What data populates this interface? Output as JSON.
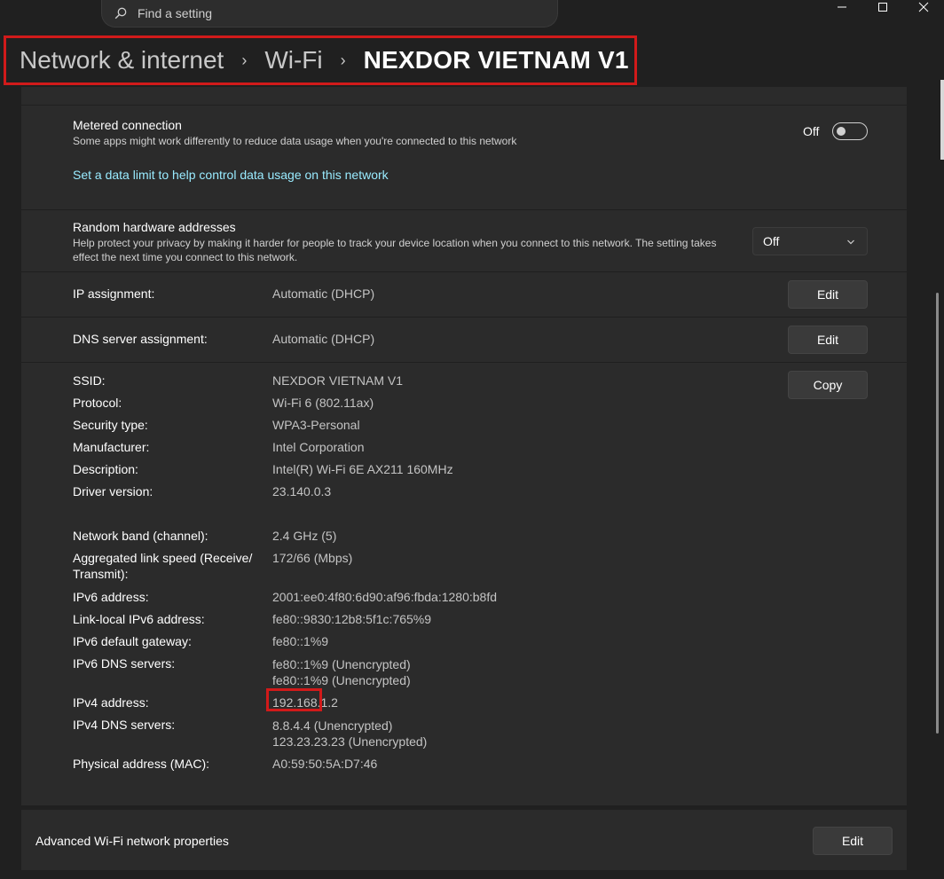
{
  "search": {
    "placeholder": "Find a setting"
  },
  "breadcrumb": {
    "items": [
      "Network & internet",
      "Wi-Fi"
    ],
    "current": "NEXDOR VIETNAM V1"
  },
  "metered": {
    "title": "Metered connection",
    "description": "Some apps might work differently to reduce data usage when you're connected to this network",
    "toggle_state": "Off",
    "link": "Set a data limit to help control data usage on this network"
  },
  "random_hw": {
    "title": "Random hardware addresses",
    "description": "Help protect your privacy by making it harder for people to track your device location when you connect to this network. The setting takes effect the next time you connect to this network.",
    "value": "Off"
  },
  "ip_assignment": {
    "label": "IP assignment:",
    "value": "Automatic (DHCP)",
    "button": "Edit"
  },
  "dns_assignment": {
    "label": "DNS server assignment:",
    "value": "Automatic (DHCP)",
    "button": "Edit"
  },
  "properties": {
    "copy_button": "Copy",
    "rows": [
      {
        "label": "SSID:",
        "value": "NEXDOR VIETNAM V1"
      },
      {
        "label": "Protocol:",
        "value": "Wi-Fi 6 (802.11ax)"
      },
      {
        "label": "Security type:",
        "value": "WPA3-Personal"
      },
      {
        "label": "Manufacturer:",
        "value": "Intel Corporation"
      },
      {
        "label": "Description:",
        "value": "Intel(R) Wi-Fi 6E AX211 160MHz"
      },
      {
        "label": "Driver version:",
        "value": "23.140.0.3"
      },
      {
        "label": "Network band (channel):",
        "value": "2.4 GHz (5)"
      },
      {
        "label": "Aggregated link speed (Receive/",
        "label2": "Transmit):",
        "value": "172/66 (Mbps)"
      },
      {
        "label": "IPv6 address:",
        "value": "2001:ee0:4f80:6d90:af96:fbda:1280:b8fd"
      },
      {
        "label": "Link-local IPv6 address:",
        "value": "fe80::9830:12b8:5f1c:765%9"
      },
      {
        "label": "IPv6 default gateway:",
        "value": "fe80::1%9"
      },
      {
        "label": "IPv6 DNS servers:",
        "value": "fe80::1%9 (Unencrypted)",
        "value2": "fe80::1%9 (Unencrypted)"
      },
      {
        "label": "IPv4 address:",
        "value": "192.168.1.2"
      },
      {
        "label": "IPv4 DNS servers:",
        "value": "8.8.4.4 (Unencrypted)",
        "value2": "123.23.23.23 (Unencrypted)"
      },
      {
        "label": "Physical address (MAC):",
        "value": "A0:59:50:5A:D7:46"
      }
    ]
  },
  "advanced": {
    "label": "Advanced Wi-Fi network properties",
    "button": "Edit"
  },
  "colors": {
    "accent_link": "#99ebff",
    "highlight_border": "#d11a1a",
    "background": "#202020",
    "card": "#2b2b2b"
  }
}
